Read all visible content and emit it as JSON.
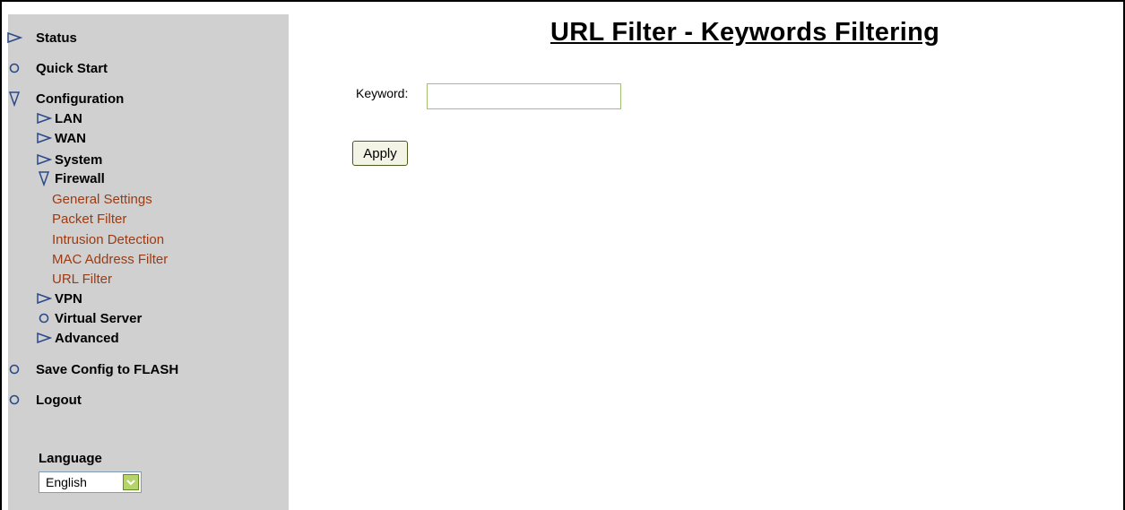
{
  "page": {
    "title": "URL Filter - Keywords Filtering"
  },
  "form": {
    "keyword_label": "Keyword:",
    "keyword_value": "",
    "apply_label": "Apply"
  },
  "sidebar": {
    "status": "Status",
    "quick_start": "Quick Start",
    "configuration": "Configuration",
    "lan": "LAN",
    "wan": "WAN",
    "system": "System",
    "firewall": "Firewall",
    "firewall_links": {
      "general_settings": "General Settings",
      "packet_filter": "Packet Filter",
      "intrusion_detection": "Intrusion Detection",
      "mac_address_filter": "MAC Address Filter",
      "url_filter": "URL Filter"
    },
    "vpn": "VPN",
    "virtual_server": "Virtual Server",
    "advanced": "Advanced",
    "save_config": "Save Config to FLASH",
    "logout": "Logout",
    "language_label": "Language",
    "language_value": "English"
  },
  "colors": {
    "sidebar_bg": "#d0d0d0",
    "link": "#9c3a12",
    "icon_blue": "#2a4a8a",
    "select_arrow": "#b7d46a"
  },
  "icons": {
    "collapsed": "triangle-right-icon",
    "expanded": "triangle-down-icon",
    "leaf": "circle-bullet-icon"
  }
}
